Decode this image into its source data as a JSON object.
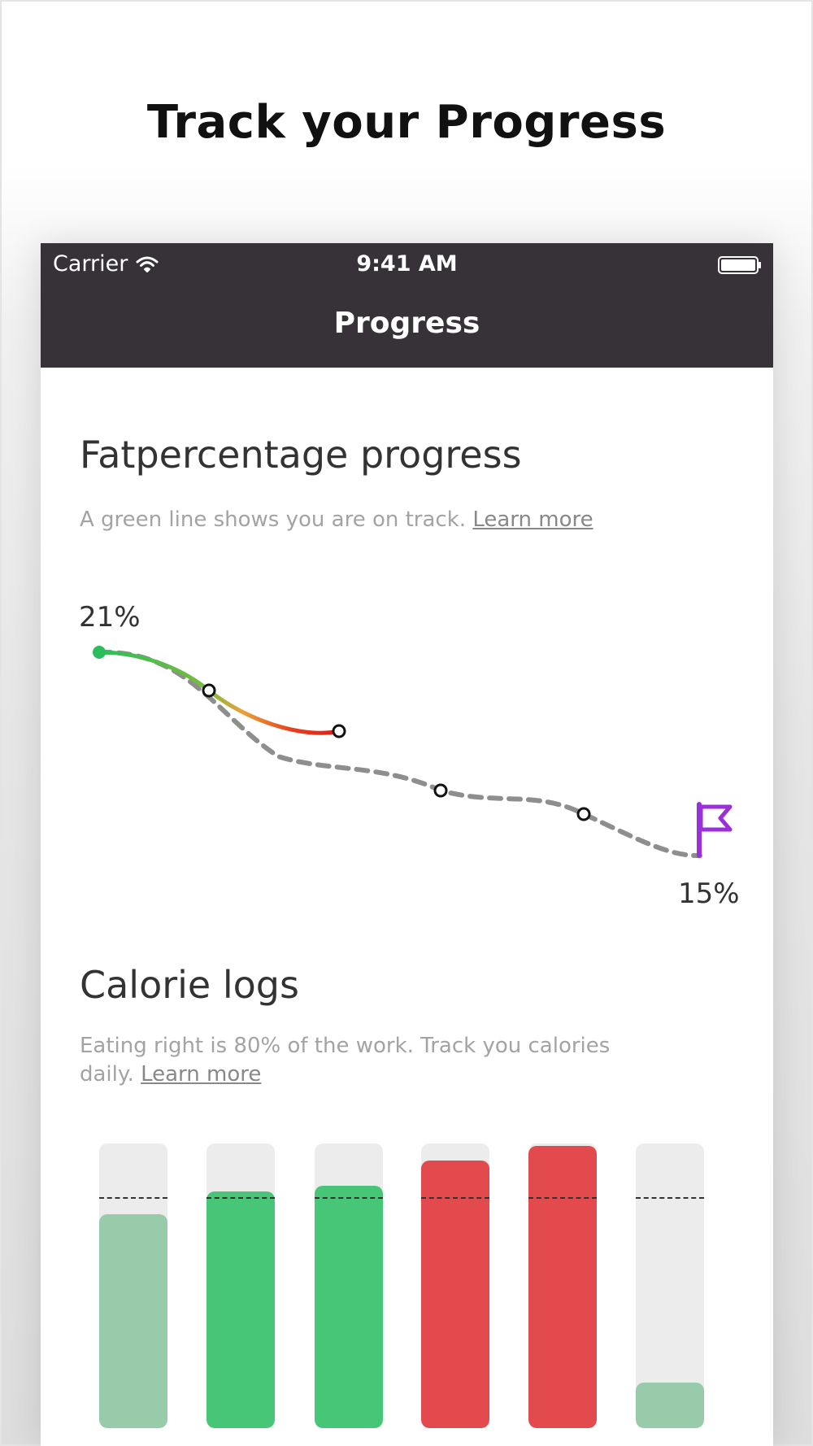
{
  "promo": {
    "headline": "Track your Progress"
  },
  "status_bar": {
    "carrier": "Carrier",
    "time": "9:41 AM"
  },
  "nav": {
    "title": "Progress"
  },
  "fat_section": {
    "title": "Fatpercentage progress",
    "description": "A green line shows you are on track.",
    "link": "Learn more"
  },
  "chart_data": [
    {
      "type": "line",
      "title": "",
      "start_label": "21%",
      "end_label": "15%",
      "series": [
        {
          "name": "",
          "values": [
            21,
            19.8,
            18.8
          ],
          "style": "gradient green-to-red"
        },
        {
          "name": "",
          "values": [
            21,
            19.8,
            18.2,
            17.6,
            16.9,
            15
          ],
          "style": "dashed gray"
        }
      ],
      "start_value": 21,
      "goal_value": 15,
      "goal_marker": "flag-icon",
      "colors": {
        "on_track": "#2bbd5c",
        "off_track": "#e01e16",
        "goal_line": "#8c8f8c",
        "flag": "#9b30d8"
      }
    },
    {
      "type": "bar",
      "title": "",
      "categories": [
        "",
        "",
        "",
        "",
        "",
        ""
      ],
      "values": [
        0.75,
        0.83,
        0.85,
        0.94,
        0.99,
        0.16
      ],
      "target": 0.81,
      "bar_colors": [
        "#97cba9",
        "#48c678",
        "#48c678",
        "#e34a4d",
        "#e34a4d",
        "#97cba9"
      ]
    }
  ],
  "calorie_section": {
    "title": "Calorie logs",
    "description": "Eating right is 80% of the work. Track you calories daily.",
    "link": "Learn more"
  },
  "colors": {
    "header_bg": "#363237",
    "track_bg": "#ececec",
    "text_dark": "#333333",
    "text_light": "#a3a3a3"
  }
}
